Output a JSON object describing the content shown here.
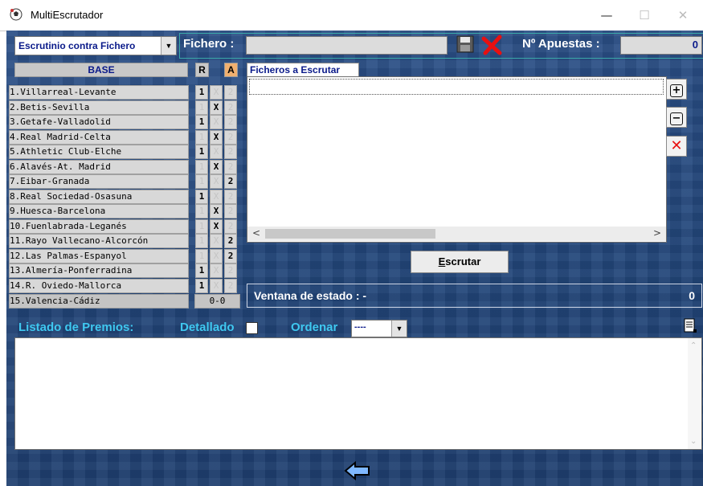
{
  "window": {
    "title": "MultiEscrutador"
  },
  "top": {
    "mode_select": "Escrutinio contra Fichero",
    "fichero_label": "Fichero :",
    "fichero_value": "",
    "apuestas_label": "Nº Apuestas :",
    "apuestas_value": "0"
  },
  "base": {
    "header": "BASE",
    "col_r": "R",
    "col_a": "A",
    "matches": [
      {
        "label": "1.Villarreal-Levante",
        "pick": "1"
      },
      {
        "label": "2.Betis-Sevilla",
        "pick": "X"
      },
      {
        "label": "3.Getafe-Valladolid",
        "pick": "1"
      },
      {
        "label": "4.Real Madrid-Celta",
        "pick": "X"
      },
      {
        "label": "5.Athletic Club-Elche",
        "pick": "1"
      },
      {
        "label": "6.Alavés-At. Madrid",
        "pick": "X"
      },
      {
        "label": "7.Eibar-Granada",
        "pick": "2"
      },
      {
        "label": "8.Real Sociedad-Osasuna",
        "pick": "1"
      },
      {
        "label": "9.Huesca-Barcelona",
        "pick": "X"
      },
      {
        "label": "10.Fuenlabrada-Leganés",
        "pick": "X"
      },
      {
        "label": "11.Rayo Vallecano-Alcorcón",
        "pick": "2"
      },
      {
        "label": "12.Las Palmas-Espanyol",
        "pick": "2"
      },
      {
        "label": "13.Almería-Ponferradina",
        "pick": "1"
      },
      {
        "label": "14.R. Oviedo-Mallorca",
        "pick": "1"
      }
    ],
    "pleno": {
      "label": "15.Valencia-Cádiz",
      "score": "0-0"
    }
  },
  "files": {
    "header": "Ficheros a Escrutar",
    "scroll_left": "<",
    "scroll_right": ">",
    "escrutar_first": "E",
    "escrutar_rest": "scrutar",
    "add_icon": "+",
    "remove_icon": "−",
    "delete_icon": "✕"
  },
  "status": {
    "label": "Ventana de estado : -",
    "value": "0"
  },
  "premios": {
    "label": "Listado de Premios:",
    "detallado_label": "Detallado",
    "ordenar_label": "Ordenar",
    "ordenar_value": "----"
  },
  "colors": {
    "accent_red": "#e81010",
    "text_blue": "#0a1a8a",
    "panel_bg": "#22467a"
  }
}
